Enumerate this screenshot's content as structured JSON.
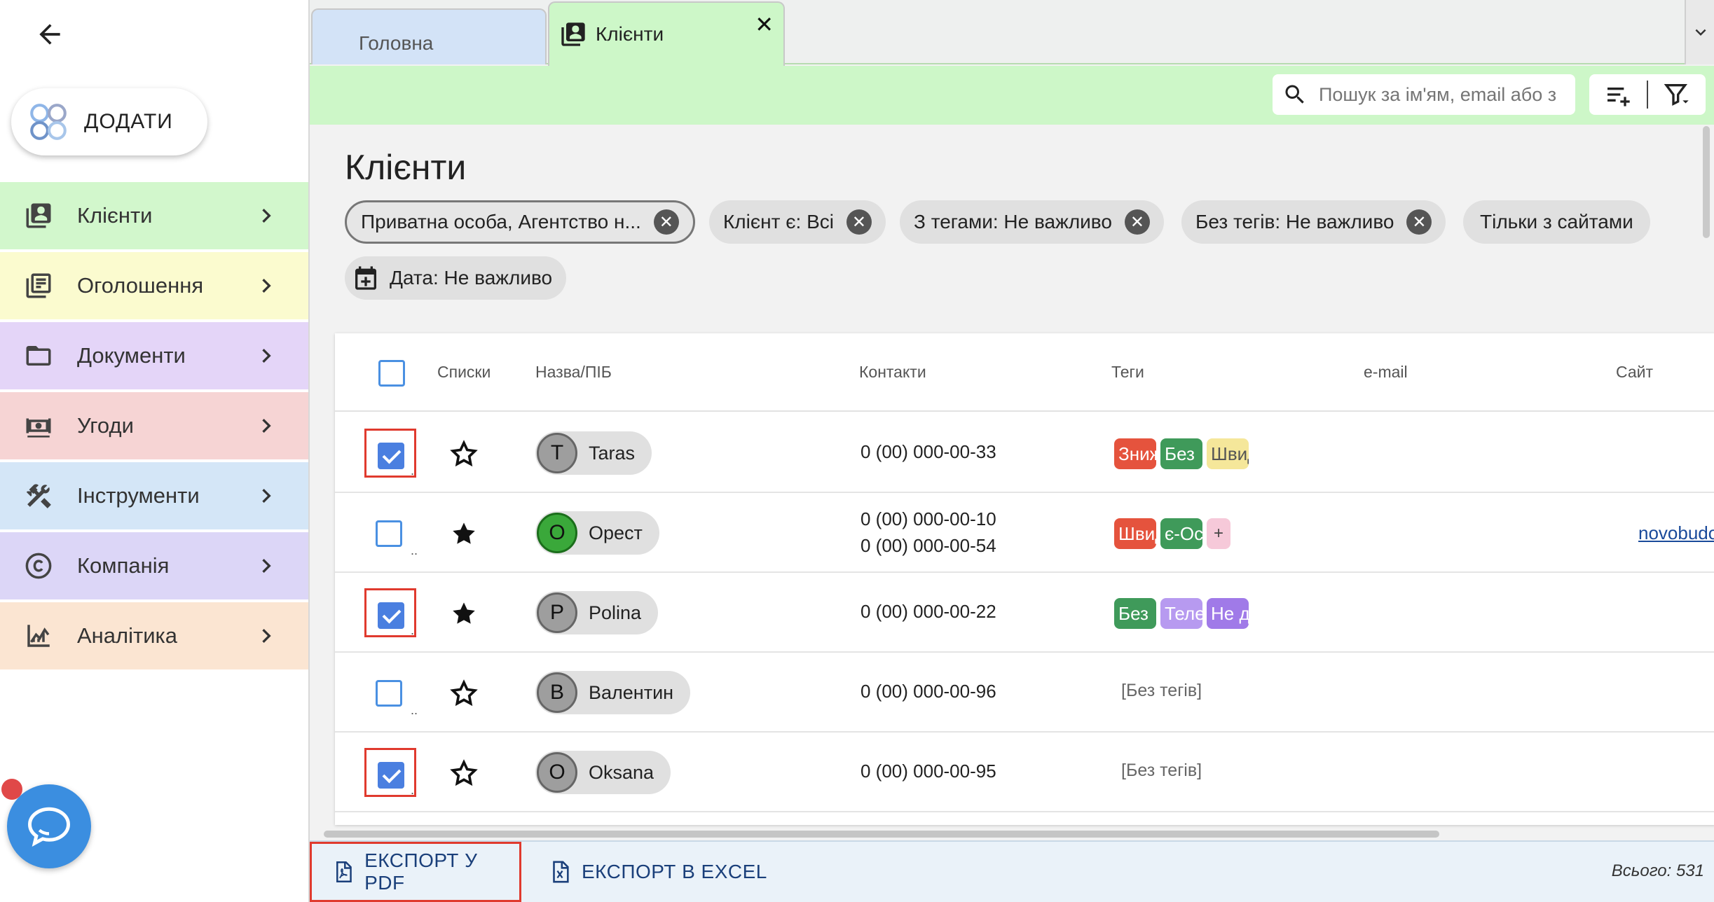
{
  "sidebar": {
    "add_label": "ДОДАТИ",
    "items": [
      {
        "label": "Клієнти",
        "icon": "contacts-icon",
        "color": "#d2f7cc"
      },
      {
        "label": "Оголошення",
        "icon": "listings-icon",
        "color": "#fbfbcf"
      },
      {
        "label": "Документи",
        "icon": "folder-icon",
        "color": "#e4d5f8"
      },
      {
        "label": "Угоди",
        "icon": "money-icon",
        "color": "#f6d4d4"
      },
      {
        "label": "Інструменти",
        "icon": "tools-icon",
        "color": "#d4e6f7"
      },
      {
        "label": "Компанія",
        "icon": "copyright-icon",
        "color": "#dcd6f7"
      },
      {
        "label": "Аналітика",
        "icon": "analytics-icon",
        "color": "#fbe5d2"
      }
    ]
  },
  "tabs": [
    {
      "label": "Головна",
      "active": false
    },
    {
      "label": "Клієнти",
      "active": true
    }
  ],
  "search": {
    "placeholder": "Пошук за ім'ям, email або з"
  },
  "page": {
    "title": "Клієнти",
    "filters": [
      "Приватна особа, Агентство н...",
      "Клієнт є: Всі",
      "З тегами: Не важливо",
      "Без тегів: Не важливо",
      "Тільки з сайтами",
      "Дата: Не важливо"
    ]
  },
  "table": {
    "headers": [
      "Списки",
      "Назва/ПІБ",
      "Контакти",
      "Теги",
      "e-mail",
      "Сайт"
    ],
    "rows": [
      {
        "checked": true,
        "starred": false,
        "initial": "T",
        "name": "Taras",
        "phones": [
          "0 (00) 000-00-33"
        ],
        "tags": [
          {
            "text": "Знижка",
            "color": "#e5533d"
          },
          {
            "text": "Без",
            "color": "#3f9a5a"
          },
          {
            "text": "Швидко",
            "color": "#f5e79a"
          }
        ],
        "site": ""
      },
      {
        "checked": false,
        "starred": true,
        "initial": "О",
        "name": "Орест",
        "phones": [
          "0 (00) 000-00-10",
          "0 (00) 000-00-54"
        ],
        "tags": [
          {
            "text": "Швидко",
            "color": "#e5533d"
          },
          {
            "text": "є-Осел",
            "color": "#3f9a5a"
          }
        ],
        "more": "+",
        "site": "novobudov"
      },
      {
        "checked": true,
        "starred": true,
        "initial": "P",
        "name": "Polina",
        "phones": [
          "0 (00) 000-00-22"
        ],
        "tags": [
          {
            "text": "Без",
            "color": "#3f9a5a"
          },
          {
            "text": "Телефон",
            "color": "#b79af0"
          },
          {
            "text": "Не д",
            "color": "#a07ae8"
          }
        ],
        "site": ""
      },
      {
        "checked": false,
        "starred": false,
        "initial": "В",
        "name": "Валентин",
        "phones": [
          "0 (00) 000-00-96"
        ],
        "no_tags": "[Без тегів]",
        "site": ""
      },
      {
        "checked": true,
        "starred": false,
        "initial": "О",
        "name": "Oksana",
        "phones": [
          "0 (00) 000-00-95"
        ],
        "no_tags": "[Без тегів]",
        "site": ""
      }
    ]
  },
  "footer": {
    "export_pdf": "ЕКСПОРТ У PDF",
    "export_excel": "ЕКСПОРТ В EXCEL",
    "total": "Всього: 531"
  }
}
